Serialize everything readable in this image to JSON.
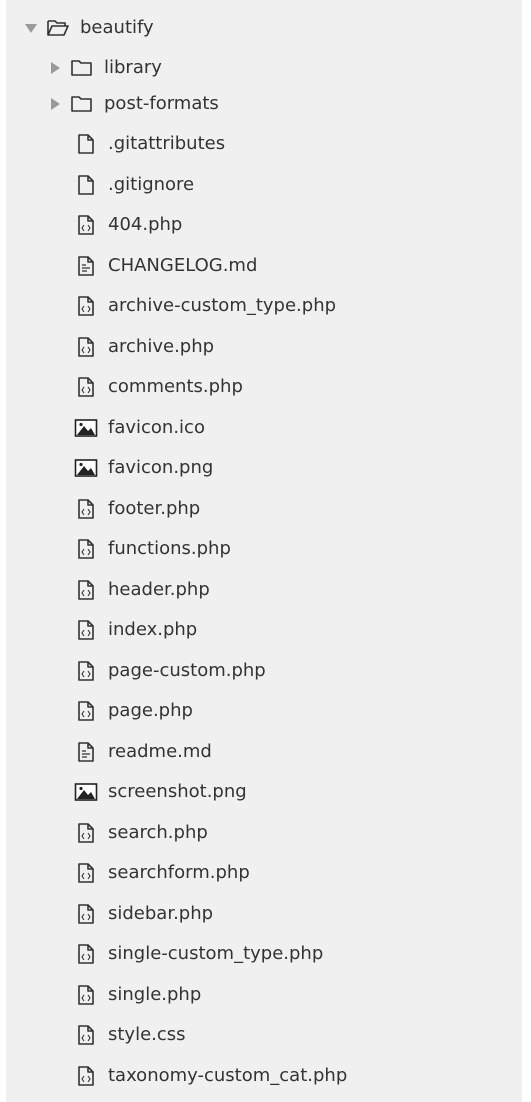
{
  "tree": {
    "root": {
      "label": "beautify",
      "expanded": true,
      "icon": "folder-open-icon"
    },
    "folders": [
      {
        "label": "library",
        "expanded": false,
        "icon": "folder-icon"
      },
      {
        "label": "post-formats",
        "expanded": false,
        "icon": "folder-icon"
      }
    ],
    "files": [
      {
        "label": ".gitattributes",
        "icon": "file-icon"
      },
      {
        "label": ".gitignore",
        "icon": "file-icon"
      },
      {
        "label": "404.php",
        "icon": "code-file-icon"
      },
      {
        "label": "CHANGELOG.md",
        "icon": "text-file-icon"
      },
      {
        "label": "archive-custom_type.php",
        "icon": "code-file-icon"
      },
      {
        "label": "archive.php",
        "icon": "code-file-icon"
      },
      {
        "label": "comments.php",
        "icon": "code-file-icon"
      },
      {
        "label": "favicon.ico",
        "icon": "image-file-icon"
      },
      {
        "label": "favicon.png",
        "icon": "image-file-icon"
      },
      {
        "label": "footer.php",
        "icon": "code-file-icon"
      },
      {
        "label": "functions.php",
        "icon": "code-file-icon"
      },
      {
        "label": "header.php",
        "icon": "code-file-icon"
      },
      {
        "label": "index.php",
        "icon": "code-file-icon"
      },
      {
        "label": "page-custom.php",
        "icon": "code-file-icon"
      },
      {
        "label": "page.php",
        "icon": "code-file-icon"
      },
      {
        "label": "readme.md",
        "icon": "text-file-icon"
      },
      {
        "label": "screenshot.png",
        "icon": "image-file-icon"
      },
      {
        "label": "search.php",
        "icon": "code-file-icon"
      },
      {
        "label": "searchform.php",
        "icon": "code-file-icon"
      },
      {
        "label": "sidebar.php",
        "icon": "code-file-icon"
      },
      {
        "label": "single-custom_type.php",
        "icon": "code-file-icon"
      },
      {
        "label": "single.php",
        "icon": "code-file-icon"
      },
      {
        "label": "style.css",
        "icon": "code-file-icon"
      },
      {
        "label": "taxonomy-custom_cat.php",
        "icon": "code-file-icon"
      }
    ]
  }
}
